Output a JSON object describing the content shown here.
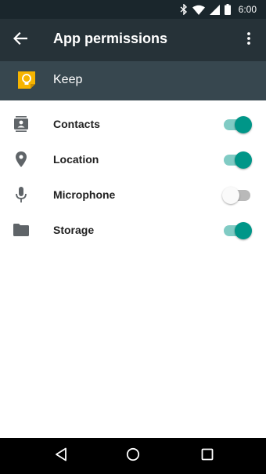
{
  "status_bar": {
    "time": "6:00",
    "icons": [
      "bluetooth-icon",
      "wifi-icon",
      "cellular-signal-icon",
      "battery-icon"
    ]
  },
  "app_bar": {
    "title": "App permissions",
    "back_icon": "arrow-back-icon",
    "overflow_icon": "more-vert-icon"
  },
  "app_header": {
    "app_name": "Keep",
    "app_icon": "keep-bulb-icon"
  },
  "permissions": [
    {
      "label": "Contacts",
      "icon": "contacts-icon",
      "enabled": true
    },
    {
      "label": "Location",
      "icon": "location-pin-icon",
      "enabled": true
    },
    {
      "label": "Microphone",
      "icon": "microphone-icon",
      "enabled": false
    },
    {
      "label": "Storage",
      "icon": "folder-icon",
      "enabled": true
    }
  ],
  "nav_bar": {
    "back_icon": "nav-back-icon",
    "home_icon": "nav-home-icon",
    "recents_icon": "nav-recents-icon"
  },
  "colors": {
    "status_bar": "#1a262c",
    "app_bar": "#263238",
    "app_header": "#37474f",
    "switch_on_thumb": "#009688",
    "switch_on_track": "#80cbc4",
    "keep_yellow": "#f6b400"
  }
}
